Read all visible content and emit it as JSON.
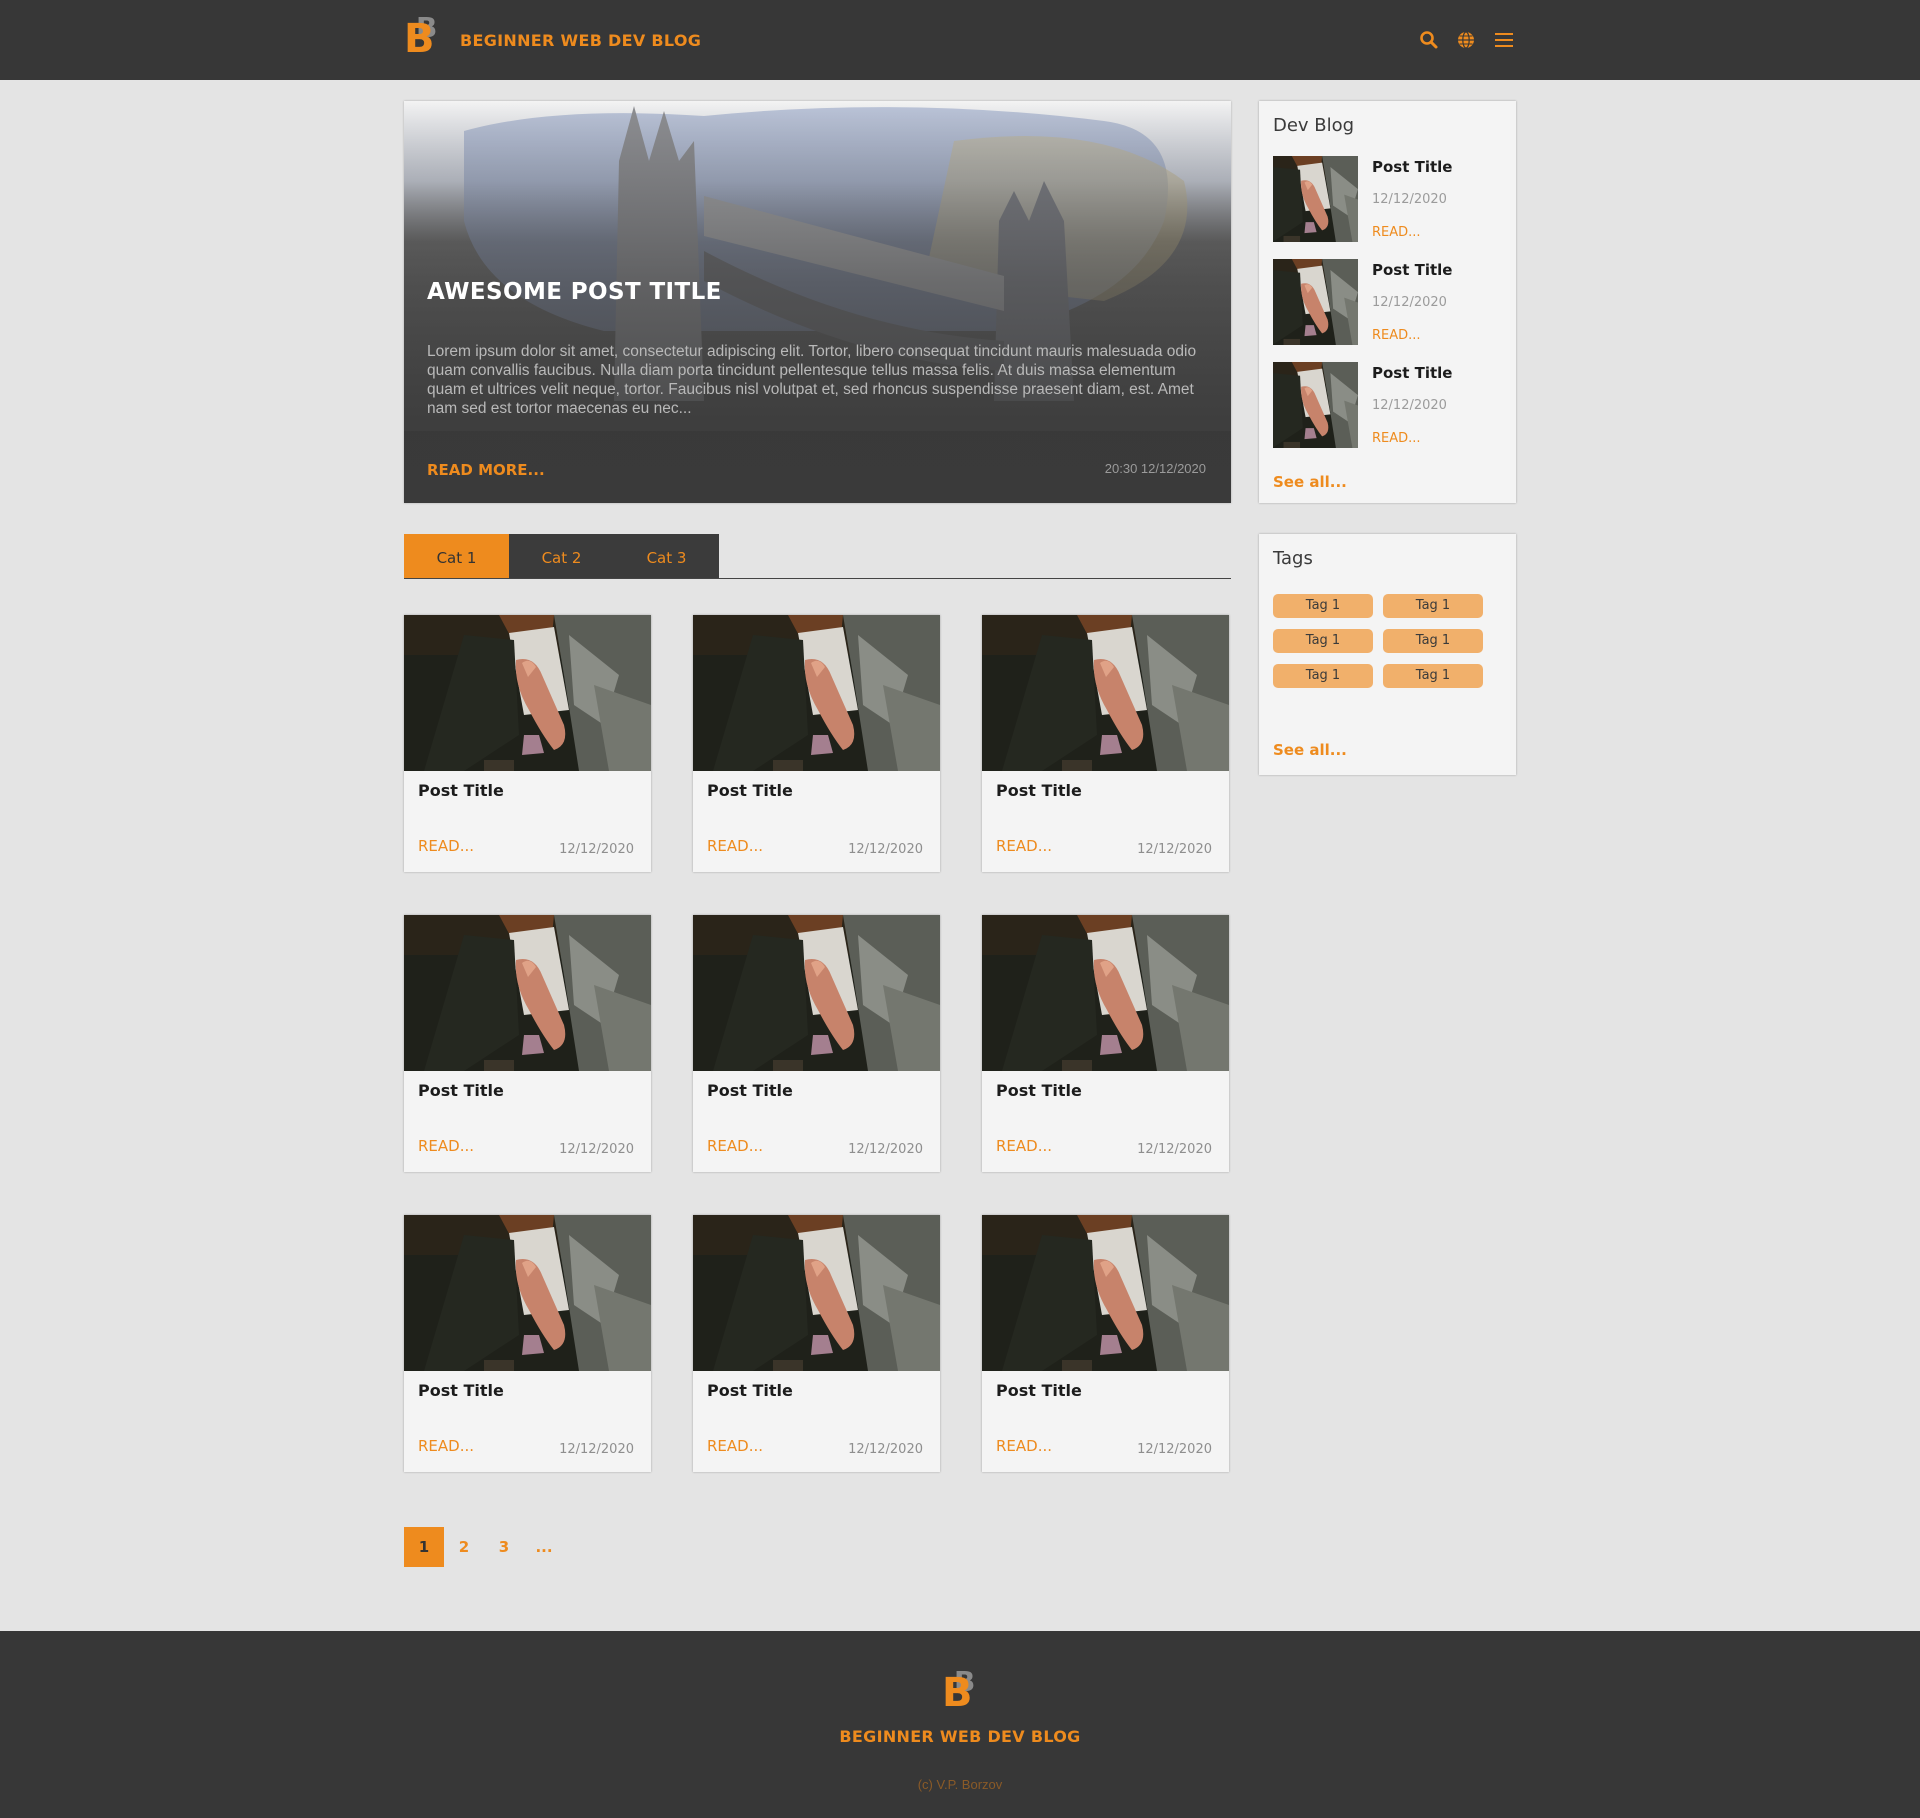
{
  "header": {
    "logo_letter": "B",
    "logo_letter_back": "B",
    "site_name": "BEGINNER WEB DEV BLOG",
    "icons": [
      "search-icon",
      "globe-icon",
      "menu-icon"
    ]
  },
  "hero": {
    "title": "AWESOME POST TITLE",
    "excerpt": "Lorem ipsum dolor sit amet, consectetur adipiscing elit. Tortor, libero consequat tincidunt mauris malesuada odio quam convallis faucibus. Nulla diam porta tincidunt pellentesque tellus massa felis. At duis massa elementum quam et ultrices velit neque, tortor. Faucibus nisl volutpat et, sed rhoncus suspendisse praesent diam, est. Amet nam sed est tortor maecenas eu nec...",
    "read_more": "READ MORE...",
    "timestamp": "20:30 12/12/2020"
  },
  "tabs": [
    {
      "label": "Cat 1",
      "active": true
    },
    {
      "label": "Cat 2",
      "active": false
    },
    {
      "label": "Cat 3",
      "active": false
    }
  ],
  "posts": [
    {
      "title": "Post Title",
      "read": "READ...",
      "date": "12/12/2020"
    },
    {
      "title": "Post Title",
      "read": "READ...",
      "date": "12/12/2020"
    },
    {
      "title": "Post Title",
      "read": "READ...",
      "date": "12/12/2020"
    },
    {
      "title": "Post Title",
      "read": "READ...",
      "date": "12/12/2020"
    },
    {
      "title": "Post Title",
      "read": "READ...",
      "date": "12/12/2020"
    },
    {
      "title": "Post Title",
      "read": "READ...",
      "date": "12/12/2020"
    },
    {
      "title": "Post Title",
      "read": "READ...",
      "date": "12/12/2020"
    },
    {
      "title": "Post Title",
      "read": "READ...",
      "date": "12/12/2020"
    },
    {
      "title": "Post Title",
      "read": "READ...",
      "date": "12/12/2020"
    }
  ],
  "pagination": [
    {
      "label": "1",
      "active": true
    },
    {
      "label": "2",
      "active": false
    },
    {
      "label": "3",
      "active": false
    },
    {
      "label": "...",
      "active": false
    }
  ],
  "sidebar": {
    "dev_blog": {
      "title": "Dev Blog",
      "items": [
        {
          "title": "Post Title",
          "date": "12/12/2020",
          "read": "READ..."
        },
        {
          "title": "Post Title",
          "date": "12/12/2020",
          "read": "READ..."
        },
        {
          "title": "Post Title",
          "date": "12/12/2020",
          "read": "READ..."
        }
      ],
      "see_all": "See all..."
    },
    "tags": {
      "title": "Tags",
      "items": [
        "Tag 1",
        "Tag 1",
        "Tag 1",
        "Tag 1",
        "Tag 1",
        "Tag 1"
      ],
      "see_all": "See all..."
    }
  },
  "footer": {
    "site_name": "BEGINNER WEB DEV BLOG",
    "copyright": "(c) V.P. Borzov"
  },
  "colors": {
    "accent": "#ee8b1e",
    "header_bg": "#373737",
    "page_bg": "#e4e4e4",
    "card_bg": "#f4f4f4",
    "tag_bg": "#f1b06b"
  }
}
